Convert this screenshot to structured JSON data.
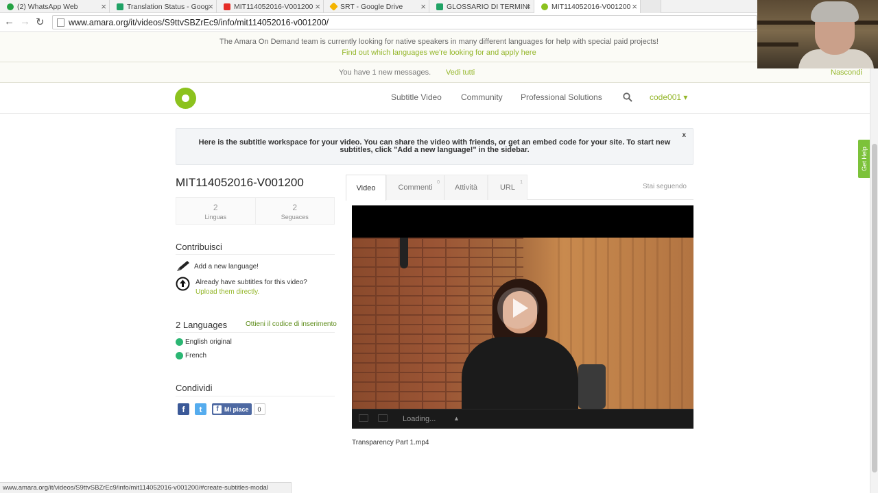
{
  "browser": {
    "tabs": [
      {
        "label": "(2) WhatsApp Web",
        "icon": "whatsapp-icon",
        "color": "#25a244"
      },
      {
        "label": "Translation Status - Goog",
        "icon": "sheets-icon",
        "color": "#21a366"
      },
      {
        "label": "MIT114052016-V001200",
        "icon": "youtube-icon",
        "color": "#e52d27"
      },
      {
        "label": "SRT - Google Drive",
        "icon": "drive-icon",
        "color": "#f4b400"
      },
      {
        "label": "GLOSSARIO DI TERMINI",
        "icon": "sheets-icon",
        "color": "#21a366"
      },
      {
        "label": "MIT114052016-V001200",
        "icon": "amara-icon",
        "color": "#8cc21e"
      }
    ],
    "url": "www.amara.org/it/videos/S9ttvSBZrEc9/info/mit114052016-v001200/",
    "status_url": "www.amara.org/it/videos/S9ttvSBZrEc9/info/mit114052016-v001200/#create-subtitles-modal"
  },
  "notice": {
    "line1": "The Amara On Demand team is currently looking for native speakers in many different languages for help with special paid projects!",
    "line2": "Find out which languages we're looking for and apply here"
  },
  "messages": {
    "text": "You have 1 new messages.",
    "view_all": "Vedi tutti",
    "hide": "Nascondi"
  },
  "header": {
    "nav": [
      "Subtitle Video",
      "Community",
      "Professional Solutions"
    ],
    "user": "code001 ▾"
  },
  "infobox": {
    "text": "Here is the subtitle workspace for your video. You can share the video with friends, or get an embed code for your site. To start new subtitles, click \"Add a new language!\" in the sidebar.",
    "close": "x"
  },
  "video": {
    "title": "MIT114052016-V001200",
    "stats": [
      {
        "value": "2",
        "label": "Linguas"
      },
      {
        "value": "2",
        "label": "Seguaces"
      }
    ],
    "filename": "Transparency Part 1.mp4",
    "loading": "Loading...",
    "caret": "▲"
  },
  "contribute": {
    "heading": "Contribuisci",
    "add_language": "Add a new language!",
    "already_have": "Already have subtitles for this video?",
    "upload": "Upload them directly."
  },
  "languages": {
    "heading": "2 Languages",
    "embed_link": "Ottieni il codice di inserimento",
    "items": [
      "English original",
      "French"
    ]
  },
  "share": {
    "heading": "Condividi",
    "like_label": "Mi piace",
    "like_count": "0"
  },
  "tabs": [
    {
      "label": "Video",
      "count": ""
    },
    {
      "label": "Commenti",
      "count": "0"
    },
    {
      "label": "Attività",
      "count": ""
    },
    {
      "label": "URL",
      "count": "1"
    }
  ],
  "following": "Stai seguendo",
  "get_help": "Get Help",
  "colors": {
    "accent": "#94b62a",
    "logo": "#8cc21e",
    "lang_dot": "#2bb673",
    "facebook": "#4e69a2",
    "twitter": "#55acee"
  }
}
